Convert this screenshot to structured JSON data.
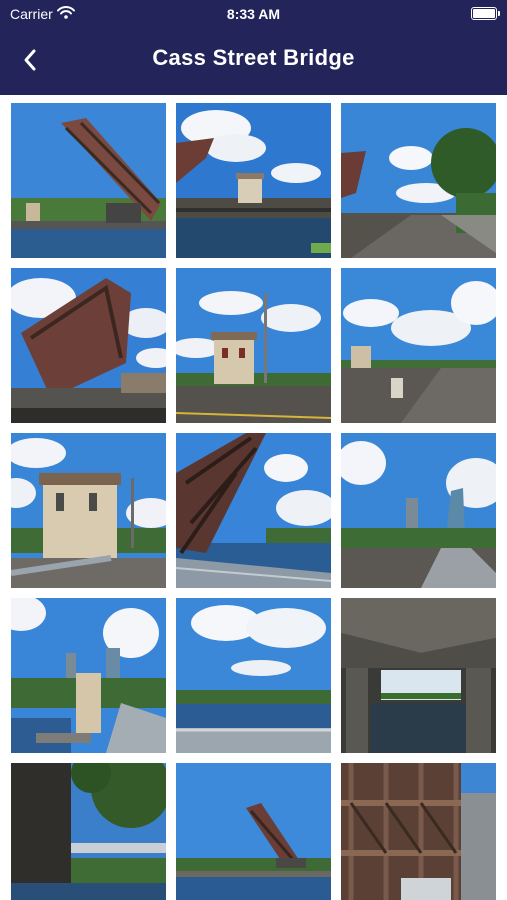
{
  "status_bar": {
    "carrier": "Carrier",
    "time": "8:33 AM",
    "battery_level": 0.9
  },
  "nav": {
    "title": "Cass Street Bridge"
  },
  "icons": {
    "back": "chevron-left-icon",
    "wifi": "wifi-icon",
    "battery": "battery-icon"
  },
  "colors": {
    "header_bg": "#22245a",
    "sky": "#3f86d6",
    "water": "#2a5c93"
  },
  "gallery": {
    "photos": [
      {
        "name": "photo-1"
      },
      {
        "name": "photo-2"
      },
      {
        "name": "photo-3"
      },
      {
        "name": "photo-4"
      },
      {
        "name": "photo-5"
      },
      {
        "name": "photo-6"
      },
      {
        "name": "photo-7"
      },
      {
        "name": "photo-8"
      },
      {
        "name": "photo-9"
      },
      {
        "name": "photo-10"
      },
      {
        "name": "photo-11"
      },
      {
        "name": "photo-12"
      },
      {
        "name": "photo-13"
      },
      {
        "name": "photo-14"
      },
      {
        "name": "photo-15"
      }
    ]
  }
}
